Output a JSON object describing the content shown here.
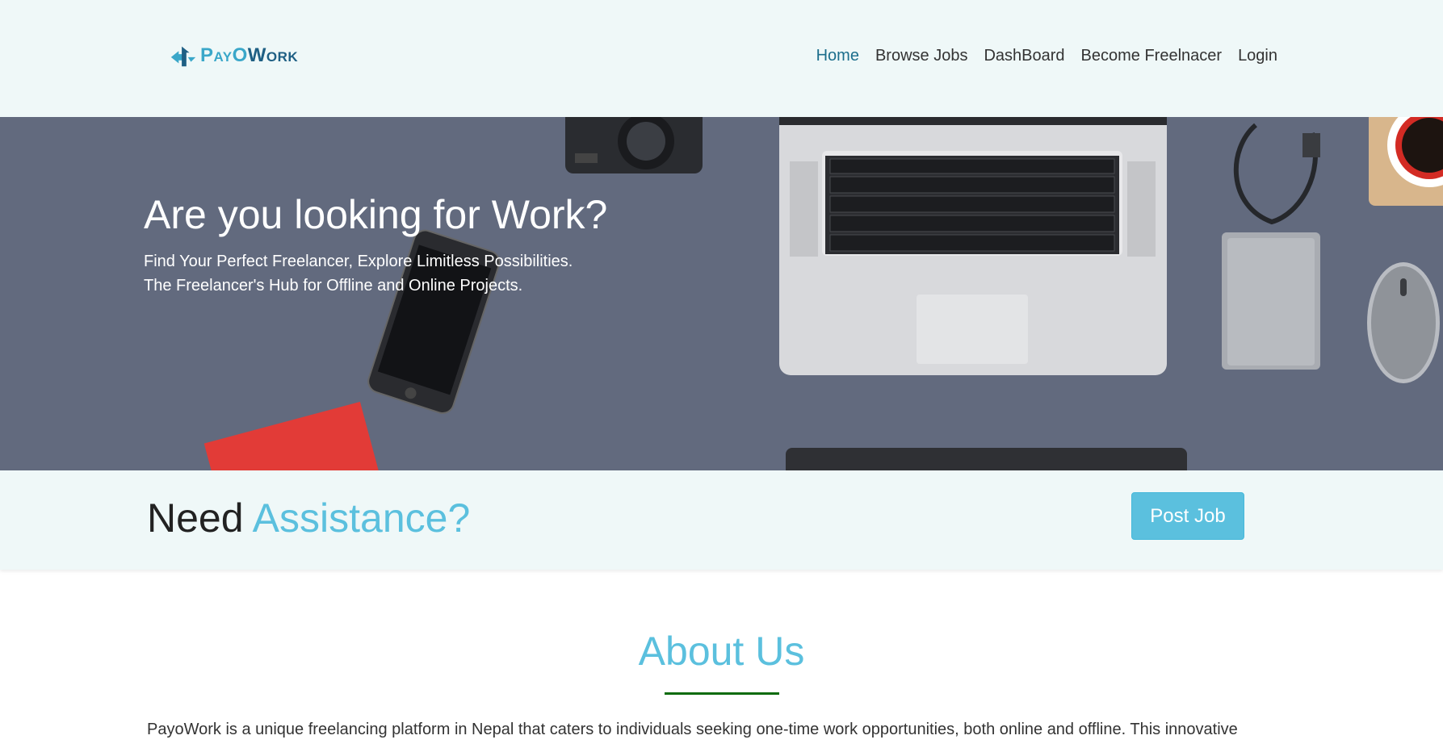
{
  "brand": {
    "name_part1": "PayO",
    "name_part2": "Work",
    "icon": "payowork-logo-icon"
  },
  "nav": {
    "items": [
      {
        "label": "Home",
        "active": true
      },
      {
        "label": "Browse Jobs",
        "active": false
      },
      {
        "label": "DashBoard",
        "active": false
      },
      {
        "label": "Become Freelnacer",
        "active": false
      },
      {
        "label": "Login",
        "active": false
      }
    ]
  },
  "hero": {
    "title": "Are you looking for Work?",
    "subtitle_line1": "Find Your Perfect Freelancer, Explore Limitless Possibilities.",
    "subtitle_line2": "The Freelancer's Hub for Offline and Online Projects."
  },
  "assist": {
    "title_plain": "Need",
    "title_highlight": "Assistance?",
    "button_label": "Post Job"
  },
  "about": {
    "title": "About Us",
    "text": "PayoWork is a unique freelancing platform in Nepal that caters to individuals seeking one-time work opportunities, both online and offline. This innovative"
  },
  "colors": {
    "accent": "#5bc0de",
    "nav_active": "#1c6e8c",
    "header_bg": "#eff8f8",
    "hero_bg": "#626a7e",
    "rule": "#0b6b0b"
  }
}
